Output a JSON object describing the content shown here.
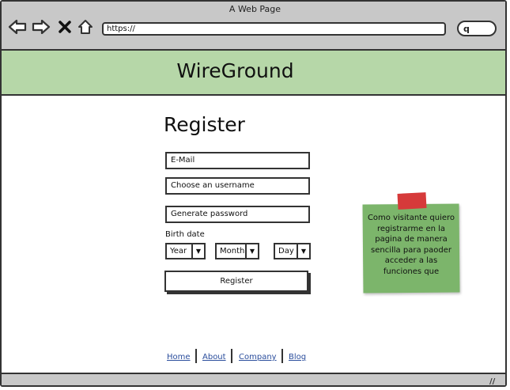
{
  "window": {
    "title": "A Web Page"
  },
  "browser": {
    "address": "https://",
    "icons": [
      "back-arrow-icon",
      "forward-arrow-icon",
      "close-icon",
      "home-icon",
      "search-icon"
    ]
  },
  "header": {
    "brand": "WireGround"
  },
  "form": {
    "title": "Register",
    "email_placeholder": "E-Mail",
    "username_placeholder": "Choose an username",
    "password_placeholder": "Generate password",
    "birth_label": "Birth date",
    "year": "Year",
    "month": "Month",
    "day": "Day",
    "submit": "Register"
  },
  "note": {
    "text": "Como visitante quiero registrarme en la pagina de manera sencilla para paoder acceder a las funciones que"
  },
  "footer": {
    "links": [
      "Home",
      "About",
      "Company",
      "Blog"
    ]
  },
  "colors": {
    "header": "#b6d7a8",
    "note": "#7cb56b",
    "tape": "#d63a3a",
    "chrome": "#c8c8c8"
  }
}
